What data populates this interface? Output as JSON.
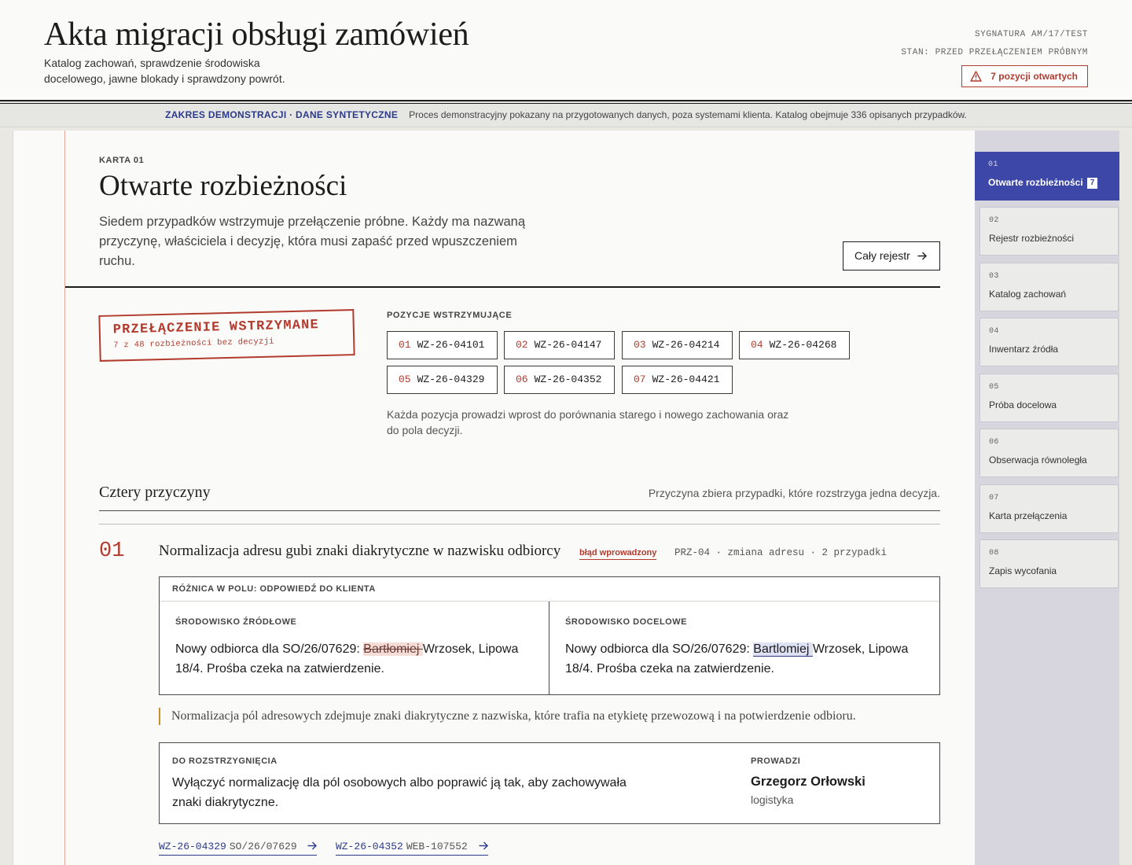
{
  "header": {
    "title": "Akta migracji obsługi zamówień",
    "subtitle": "Katalog zachowań, sprawdzenie środowiska docelowego, jawne blokady i sprawdzony powrót.",
    "signature": "SYGNATURA AM/17/TEST",
    "status": "STAN: PRZED PRZEŁĄCZENIEM PRÓBNYM",
    "open_badge": "7 pozycji otwartych"
  },
  "banner": {
    "label": "ZAKRES DEMONSTRACJI · DANE SYNTETYCZNE",
    "text": "Proces demonstracyjny pokazany na przygotowanych danych, poza systemami klienta. Katalog obejmuje 336 opisanych przypadków."
  },
  "card": {
    "eyebrow": "KARTA 01",
    "title": "Otwarte rozbieżności",
    "lead": "Siedem przypadków wstrzymuje przełączenie próbne. Każdy ma nazwaną przyczynę, właściciela i decyzję, która musi zapaść przed wpuszczeniem ruchu.",
    "register_button": "Cały rejestr"
  },
  "stamp": {
    "title": "PRZEŁĄCZENIE WSTRZYMANE",
    "subtitle": "7 z 48 rozbieżności bez decyzji"
  },
  "blockers": {
    "label": "POZYCJE WSTRZYMUJĄCE",
    "items": [
      {
        "num": "01",
        "id": "WZ-26-04101"
      },
      {
        "num": "02",
        "id": "WZ-26-04147"
      },
      {
        "num": "03",
        "id": "WZ-26-04214"
      },
      {
        "num": "04",
        "id": "WZ-26-04268"
      },
      {
        "num": "05",
        "id": "WZ-26-04329"
      },
      {
        "num": "06",
        "id": "WZ-26-04352"
      },
      {
        "num": "07",
        "id": "WZ-26-04421"
      }
    ],
    "note": "Każda pozycja prowadzi wprost do porównania starego i nowego zachowania oraz do pola decyzji."
  },
  "causes": {
    "title": "Cztery przyczyny",
    "note": "Przyczyna zbiera przypadki, które rozstrzyga jedna decyzja.",
    "items": [
      {
        "num": "01",
        "title": "Normalizacja adresu gubi znaki diakrytyczne w nazwisku odbiorcy",
        "tag": "błąd wprowadzony",
        "meta": "PRZ-04 · zmiana adresu · 2 przypadki",
        "diff": {
          "header": "RÓŻNICA W POLU: ODPOWIEDŹ DO KLIENTA",
          "source_label": "ŚRODOWISKO ŹRÓDŁOWE",
          "source_before": "Nowy odbiorca dla SO/26/07629: ",
          "source_changed": "Bartłomiej ",
          "source_after": "Wrzosek, Lipowa 18/4. Prośba czeka na zatwierdzenie.",
          "target_label": "ŚRODOWISKO DOCELOWE",
          "target_before": "Nowy odbiorca dla SO/26/07629: ",
          "target_changed": "Bartlomiej ",
          "target_after": "Wrzosek, Lipowa 18/4. Prośba czeka na zatwierdzenie."
        },
        "explanation": "Normalizacja pól adresowych zdejmuje znaki diakrytyczne z nazwiska, które trafia na etykietę przewozową i na potwierdzenie odbioru.",
        "decision": {
          "label": "DO ROZSTRZYGNIĘCIA",
          "text": "Wyłączyć normalizację dla pól osobowych albo poprawić ją tak, aby zachowywała znaki diakrytyczne.",
          "owner_label": "PROWADZI",
          "owner_name": "Grzegorz Orłowski",
          "owner_dept": "logistyka"
        },
        "cases": [
          {
            "id": "WZ-26-04329",
            "ref": "SO/26/07629"
          },
          {
            "id": "WZ-26-04352",
            "ref": "WEB-107552"
          }
        ]
      }
    ]
  },
  "sidebar": {
    "items": [
      {
        "num": "01",
        "label": "Otwarte rozbieżności",
        "count": "7"
      },
      {
        "num": "02",
        "label": "Rejestr rozbieżności"
      },
      {
        "num": "03",
        "label": "Katalog zachowań"
      },
      {
        "num": "04",
        "label": "Inwentarz źródła"
      },
      {
        "num": "05",
        "label": "Próba docelowa"
      },
      {
        "num": "06",
        "label": "Obserwacja równoległa"
      },
      {
        "num": "07",
        "label": "Karta przełączenia"
      },
      {
        "num": "08",
        "label": "Zapis wycofania"
      }
    ]
  },
  "colors": {
    "accent_red": "#b23b2e",
    "accent_blue": "#3d47a8",
    "link_blue": "#2c3a8c",
    "amber": "#c98f2a"
  },
  "icons": {
    "warning": "warning-triangle-icon",
    "arrow": "arrow-right-icon"
  }
}
